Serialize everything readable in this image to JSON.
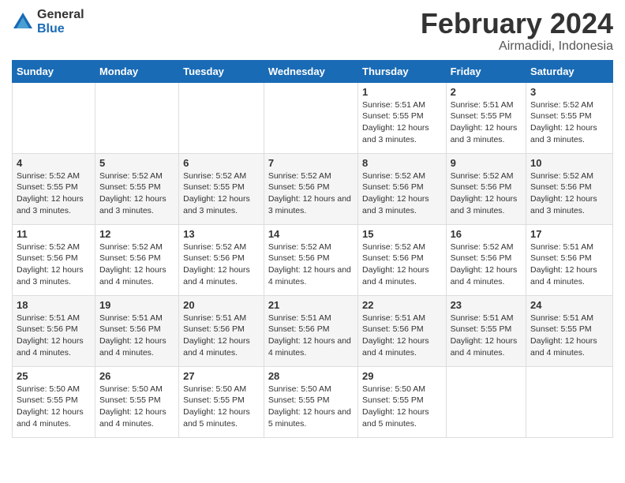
{
  "logo": {
    "general": "General",
    "blue": "Blue"
  },
  "title": "February 2024",
  "subtitle": "Airmadidi, Indonesia",
  "days_of_week": [
    "Sunday",
    "Monday",
    "Tuesday",
    "Wednesday",
    "Thursday",
    "Friday",
    "Saturday"
  ],
  "weeks": [
    [
      {
        "day": "",
        "sunrise": "",
        "sunset": "",
        "daylight": ""
      },
      {
        "day": "",
        "sunrise": "",
        "sunset": "",
        "daylight": ""
      },
      {
        "day": "",
        "sunrise": "",
        "sunset": "",
        "daylight": ""
      },
      {
        "day": "",
        "sunrise": "",
        "sunset": "",
        "daylight": ""
      },
      {
        "day": "1",
        "sunrise": "Sunrise: 5:51 AM",
        "sunset": "Sunset: 5:55 PM",
        "daylight": "Daylight: 12 hours and 3 minutes."
      },
      {
        "day": "2",
        "sunrise": "Sunrise: 5:51 AM",
        "sunset": "Sunset: 5:55 PM",
        "daylight": "Daylight: 12 hours and 3 minutes."
      },
      {
        "day": "3",
        "sunrise": "Sunrise: 5:52 AM",
        "sunset": "Sunset: 5:55 PM",
        "daylight": "Daylight: 12 hours and 3 minutes."
      }
    ],
    [
      {
        "day": "4",
        "sunrise": "Sunrise: 5:52 AM",
        "sunset": "Sunset: 5:55 PM",
        "daylight": "Daylight: 12 hours and 3 minutes."
      },
      {
        "day": "5",
        "sunrise": "Sunrise: 5:52 AM",
        "sunset": "Sunset: 5:55 PM",
        "daylight": "Daylight: 12 hours and 3 minutes."
      },
      {
        "day": "6",
        "sunrise": "Sunrise: 5:52 AM",
        "sunset": "Sunset: 5:55 PM",
        "daylight": "Daylight: 12 hours and 3 minutes."
      },
      {
        "day": "7",
        "sunrise": "Sunrise: 5:52 AM",
        "sunset": "Sunset: 5:56 PM",
        "daylight": "Daylight: 12 hours and 3 minutes."
      },
      {
        "day": "8",
        "sunrise": "Sunrise: 5:52 AM",
        "sunset": "Sunset: 5:56 PM",
        "daylight": "Daylight: 12 hours and 3 minutes."
      },
      {
        "day": "9",
        "sunrise": "Sunrise: 5:52 AM",
        "sunset": "Sunset: 5:56 PM",
        "daylight": "Daylight: 12 hours and 3 minutes."
      },
      {
        "day": "10",
        "sunrise": "Sunrise: 5:52 AM",
        "sunset": "Sunset: 5:56 PM",
        "daylight": "Daylight: 12 hours and 3 minutes."
      }
    ],
    [
      {
        "day": "11",
        "sunrise": "Sunrise: 5:52 AM",
        "sunset": "Sunset: 5:56 PM",
        "daylight": "Daylight: 12 hours and 3 minutes."
      },
      {
        "day": "12",
        "sunrise": "Sunrise: 5:52 AM",
        "sunset": "Sunset: 5:56 PM",
        "daylight": "Daylight: 12 hours and 4 minutes."
      },
      {
        "day": "13",
        "sunrise": "Sunrise: 5:52 AM",
        "sunset": "Sunset: 5:56 PM",
        "daylight": "Daylight: 12 hours and 4 minutes."
      },
      {
        "day": "14",
        "sunrise": "Sunrise: 5:52 AM",
        "sunset": "Sunset: 5:56 PM",
        "daylight": "Daylight: 12 hours and 4 minutes."
      },
      {
        "day": "15",
        "sunrise": "Sunrise: 5:52 AM",
        "sunset": "Sunset: 5:56 PM",
        "daylight": "Daylight: 12 hours and 4 minutes."
      },
      {
        "day": "16",
        "sunrise": "Sunrise: 5:52 AM",
        "sunset": "Sunset: 5:56 PM",
        "daylight": "Daylight: 12 hours and 4 minutes."
      },
      {
        "day": "17",
        "sunrise": "Sunrise: 5:51 AM",
        "sunset": "Sunset: 5:56 PM",
        "daylight": "Daylight: 12 hours and 4 minutes."
      }
    ],
    [
      {
        "day": "18",
        "sunrise": "Sunrise: 5:51 AM",
        "sunset": "Sunset: 5:56 PM",
        "daylight": "Daylight: 12 hours and 4 minutes."
      },
      {
        "day": "19",
        "sunrise": "Sunrise: 5:51 AM",
        "sunset": "Sunset: 5:56 PM",
        "daylight": "Daylight: 12 hours and 4 minutes."
      },
      {
        "day": "20",
        "sunrise": "Sunrise: 5:51 AM",
        "sunset": "Sunset: 5:56 PM",
        "daylight": "Daylight: 12 hours and 4 minutes."
      },
      {
        "day": "21",
        "sunrise": "Sunrise: 5:51 AM",
        "sunset": "Sunset: 5:56 PM",
        "daylight": "Daylight: 12 hours and 4 minutes."
      },
      {
        "day": "22",
        "sunrise": "Sunrise: 5:51 AM",
        "sunset": "Sunset: 5:56 PM",
        "daylight": "Daylight: 12 hours and 4 minutes."
      },
      {
        "day": "23",
        "sunrise": "Sunrise: 5:51 AM",
        "sunset": "Sunset: 5:55 PM",
        "daylight": "Daylight: 12 hours and 4 minutes."
      },
      {
        "day": "24",
        "sunrise": "Sunrise: 5:51 AM",
        "sunset": "Sunset: 5:55 PM",
        "daylight": "Daylight: 12 hours and 4 minutes."
      }
    ],
    [
      {
        "day": "25",
        "sunrise": "Sunrise: 5:50 AM",
        "sunset": "Sunset: 5:55 PM",
        "daylight": "Daylight: 12 hours and 4 minutes."
      },
      {
        "day": "26",
        "sunrise": "Sunrise: 5:50 AM",
        "sunset": "Sunset: 5:55 PM",
        "daylight": "Daylight: 12 hours and 4 minutes."
      },
      {
        "day": "27",
        "sunrise": "Sunrise: 5:50 AM",
        "sunset": "Sunset: 5:55 PM",
        "daylight": "Daylight: 12 hours and 5 minutes."
      },
      {
        "day": "28",
        "sunrise": "Sunrise: 5:50 AM",
        "sunset": "Sunset: 5:55 PM",
        "daylight": "Daylight: 12 hours and 5 minutes."
      },
      {
        "day": "29",
        "sunrise": "Sunrise: 5:50 AM",
        "sunset": "Sunset: 5:55 PM",
        "daylight": "Daylight: 12 hours and 5 minutes."
      },
      {
        "day": "",
        "sunrise": "",
        "sunset": "",
        "daylight": ""
      },
      {
        "day": "",
        "sunrise": "",
        "sunset": "",
        "daylight": ""
      }
    ]
  ]
}
